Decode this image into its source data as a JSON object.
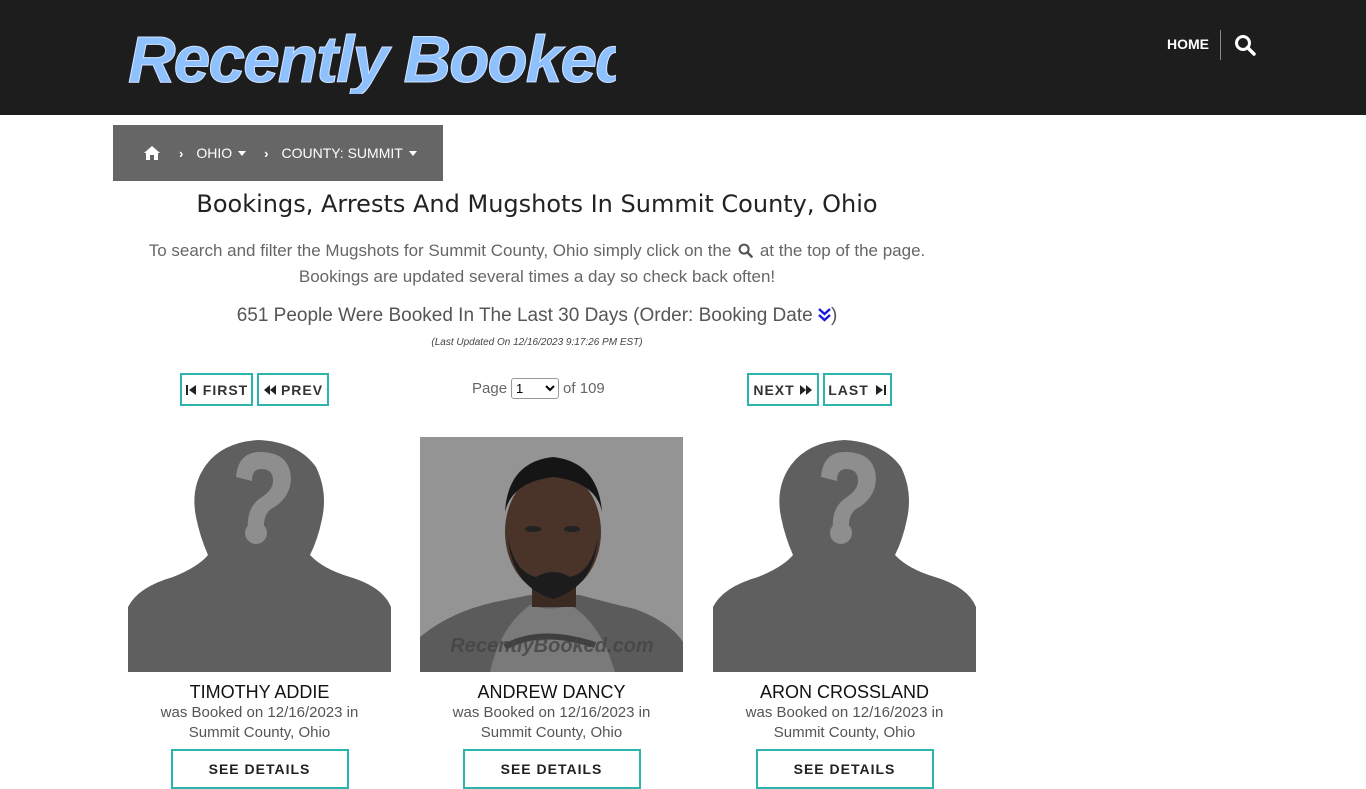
{
  "header": {
    "logo_text": "Recently Booked",
    "nav": {
      "home_label": "HOME"
    }
  },
  "breadcrumb": {
    "state_label": "OHIO",
    "county_label": "COUNTY: SUMMIT"
  },
  "main": {
    "title": "Bookings, Arrests And Mugshots In Summit County, Ohio",
    "intro_before": "To search and filter the Mugshots for Summit County, Ohio simply click on the",
    "intro_after": "at the top of the page. Bookings are updated several times a day so check back often!",
    "count_text": "651 People Were Booked In The Last 30 Days (Order: Booking Date",
    "count_close": ")",
    "last_updated": "(Last Updated On 12/16/2023 9:17:26 PM EST)"
  },
  "pagination": {
    "first_label": "FIRST",
    "prev_label": "PREV",
    "next_label": "NEXT",
    "last_label": "LAST",
    "page_label": "Page",
    "current_page": "1",
    "of_label": "of 109"
  },
  "bookings": [
    {
      "name": "TIMOTHY ADDIE",
      "desc_line1": "was Booked on 12/16/2023 in",
      "desc_line2": "Summit County, Ohio",
      "photo": "placeholder-silhouette",
      "button": "SEE DETAILS"
    },
    {
      "name": "ANDREW DANCY",
      "desc_line1": "was Booked on 12/16/2023 in",
      "desc_line2": "Summit County, Ohio",
      "photo": "mugshot",
      "watermark": "RecentlyBooked.com",
      "button": "SEE DETAILS"
    },
    {
      "name": "ARON CROSSLAND",
      "desc_line1": "was Booked on 12/16/2023 in",
      "desc_line2": "Summit County, Ohio",
      "photo": "placeholder-silhouette",
      "button": "SEE DETAILS"
    }
  ],
  "colors": {
    "header_bg": "#1d1d1d",
    "breadcrumb_bg": "#666666",
    "accent_border": "#2bb5ad",
    "logo_blue": "#8fc1ff"
  }
}
